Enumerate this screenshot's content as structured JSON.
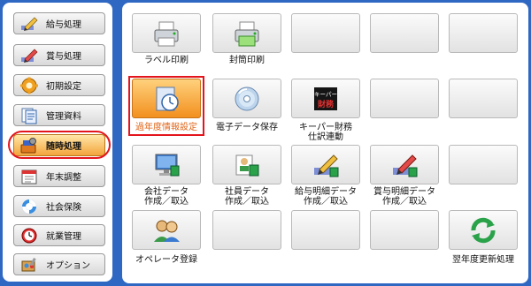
{
  "sidebar": {
    "items": [
      {
        "label": "給与処理",
        "icon": "pencil-icon"
      },
      {
        "label": "賞与処理",
        "icon": "pencil-icon"
      },
      {
        "label": "初期設定",
        "icon": "gear-icon"
      },
      {
        "label": "管理資料",
        "icon": "document-icon"
      },
      {
        "label": "随時処理",
        "icon": "tools-icon",
        "active": true
      },
      {
        "label": "年末調整",
        "icon": "calendar-icon"
      },
      {
        "label": "社会保険",
        "icon": "lifebuoy-icon"
      },
      {
        "label": "就業管理",
        "icon": "clock-icon"
      },
      {
        "label": "オプション",
        "icon": "wrench-icon"
      }
    ]
  },
  "tiles": {
    "print_label": "ラベル印刷",
    "envelope_print": "封筒印刷",
    "past_year_info": "過年度情報設定",
    "edoc_save": "電子データ保存",
    "keeper_link": "キーパー財務\n仕訳連動",
    "company_data": "会社データ\n作成／取込",
    "employee_data": "社員データ\n作成／取込",
    "salary_detail": "給与明細データ\n作成／取込",
    "bonus_detail": "賞与明細データ\n作成／取込",
    "operator_reg": "オペレータ登録",
    "year_update": "翌年度更新処理",
    "keeper_badge": "キーパー",
    "keeper_badge_sub": "財務"
  },
  "colors": {
    "frame_bg": "#2f68c3",
    "active_bg": "#f3a43c",
    "highlight_ring": "#e3141c",
    "selected_text": "#e0661a"
  }
}
